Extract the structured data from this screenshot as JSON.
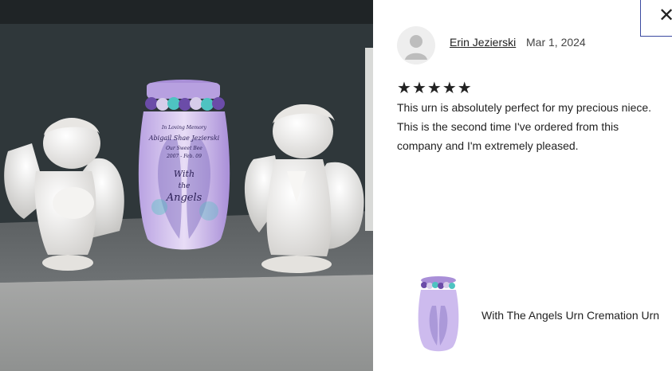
{
  "photo": {
    "alt": "",
    "urn_text": {
      "line1": "In Loving Memory",
      "line2": "Abigail Shae Jezierski",
      "line3": "Our Sweet Bee",
      "line4": "2007 - Feb. 09",
      "line5": "With",
      "line6": "the",
      "line7": "Angels"
    }
  },
  "close": {
    "glyph": "✕"
  },
  "review": {
    "reviewer": "Erin Jezierski",
    "date": "Mar 1, 2024",
    "rating": 5,
    "stars": [
      "★",
      "★",
      "★",
      "★",
      "★"
    ],
    "lines": [
      "This urn is absolutely perfect for my precious niece.",
      "This is the second time I've ordered from this",
      "company and I'm extremely pleased."
    ]
  },
  "product": {
    "name": "With The Angels Urn Cremation Urn"
  },
  "colors": {
    "urn_lavender": "#c9b6ea",
    "urn_purple": "#6b4ca8",
    "rose_teal": "#4ec3c1",
    "angel_white": "#f1f0ee",
    "close_border": "#3b4aa0"
  }
}
